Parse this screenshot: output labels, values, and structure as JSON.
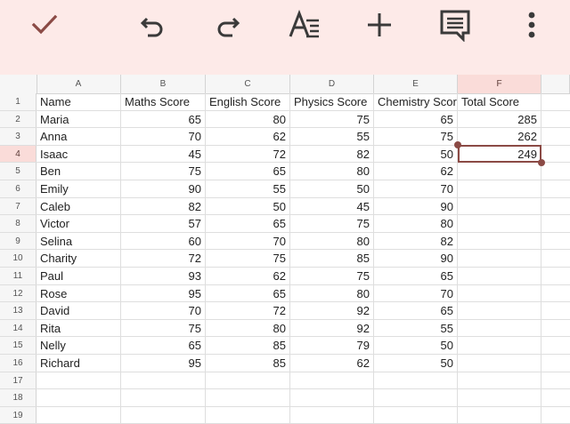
{
  "toolbar": {
    "buttons": [
      {
        "name": "confirm-button",
        "icon": "check-icon"
      },
      {
        "name": "undo-button",
        "icon": "undo-icon"
      },
      {
        "name": "redo-button",
        "icon": "redo-icon"
      },
      {
        "name": "text-format-button",
        "icon": "text-format-icon"
      },
      {
        "name": "insert-button",
        "icon": "plus-icon"
      },
      {
        "name": "comment-button",
        "icon": "comment-icon"
      },
      {
        "name": "more-button",
        "icon": "more-vert-icon"
      }
    ],
    "accent_color": "#8b4a45",
    "background_color": "#fdeae8"
  },
  "sheet": {
    "columns": [
      "A",
      "B",
      "C",
      "D",
      "E",
      "F"
    ],
    "selected_column": "F",
    "selected_row": 4,
    "rows": [
      {
        "num": "1",
        "cells": [
          "Name",
          "Maths Score",
          "English Score",
          "Physics Score",
          "Chemistry Score",
          "Total Score"
        ]
      },
      {
        "num": "2",
        "cells": [
          "Maria",
          "65",
          "80",
          "75",
          "65",
          "285"
        ]
      },
      {
        "num": "3",
        "cells": [
          "Anna",
          "70",
          "62",
          "55",
          "75",
          "262"
        ]
      },
      {
        "num": "4",
        "cells": [
          "Isaac",
          "45",
          "72",
          "82",
          "50",
          "249"
        ]
      },
      {
        "num": "5",
        "cells": [
          "Ben",
          "75",
          "65",
          "80",
          "62",
          ""
        ]
      },
      {
        "num": "6",
        "cells": [
          "Emily",
          "90",
          "55",
          "50",
          "70",
          ""
        ]
      },
      {
        "num": "7",
        "cells": [
          "Caleb",
          "82",
          "50",
          "45",
          "90",
          ""
        ]
      },
      {
        "num": "8",
        "cells": [
          "Victor",
          "57",
          "65",
          "75",
          "80",
          ""
        ]
      },
      {
        "num": "9",
        "cells": [
          "Selina",
          "60",
          "70",
          "80",
          "82",
          ""
        ]
      },
      {
        "num": "10",
        "cells": [
          "Charity",
          "72",
          "75",
          "85",
          "90",
          ""
        ]
      },
      {
        "num": "11",
        "cells": [
          "Paul",
          "93",
          "62",
          "75",
          "65",
          ""
        ]
      },
      {
        "num": "12",
        "cells": [
          "Rose",
          "95",
          "65",
          "80",
          "70",
          ""
        ]
      },
      {
        "num": "13",
        "cells": [
          "David",
          "70",
          "72",
          "92",
          "65",
          ""
        ]
      },
      {
        "num": "14",
        "cells": [
          "Rita",
          "75",
          "80",
          "92",
          "55",
          ""
        ]
      },
      {
        "num": "15",
        "cells": [
          "Nelly",
          "65",
          "85",
          "79",
          "50",
          ""
        ]
      },
      {
        "num": "16",
        "cells": [
          "Richard",
          "95",
          "85",
          "62",
          "50",
          ""
        ]
      },
      {
        "num": "17",
        "cells": [
          "",
          "",
          "",
          "",
          "",
          ""
        ]
      },
      {
        "num": "18",
        "cells": [
          "",
          "",
          "",
          "",
          "",
          ""
        ]
      },
      {
        "num": "19",
        "cells": [
          "",
          "",
          "",
          "",
          "",
          ""
        ]
      }
    ]
  }
}
